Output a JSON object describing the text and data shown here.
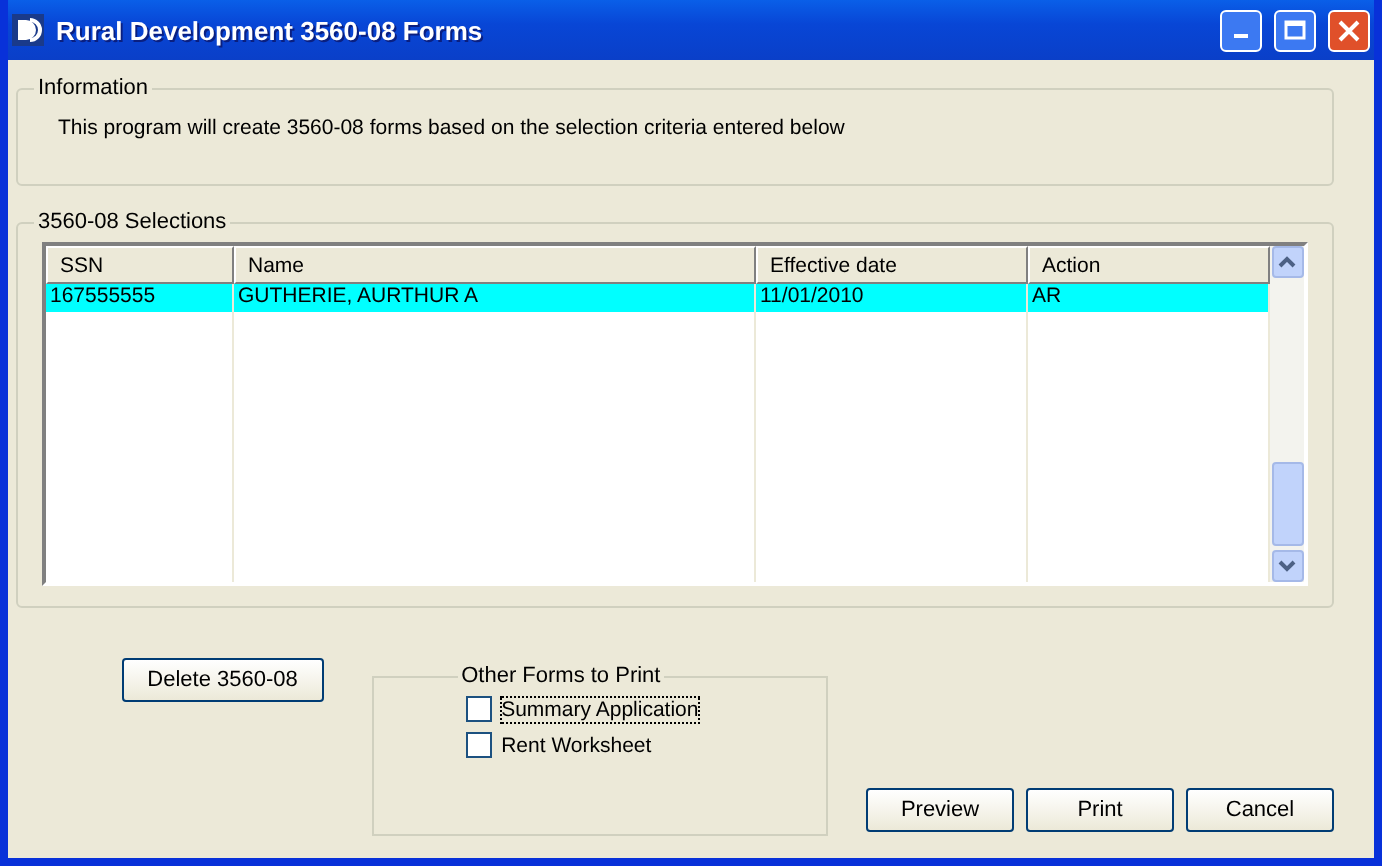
{
  "window": {
    "title": "Rural Development 3560-08 Forms"
  },
  "information": {
    "title": "Information",
    "text": "This program will create 3560-08 forms based on the selection criteria entered below"
  },
  "selections": {
    "title": "3560-08 Selections",
    "columns": [
      "SSN",
      "Name",
      "Effective date",
      "Action"
    ],
    "rows": [
      {
        "cells": [
          "167555555",
          "GUTHERIE, AURTHUR A",
          "11/01/2010",
          "AR"
        ],
        "selected": true
      }
    ]
  },
  "delete_button": "Delete 3560-08",
  "other_forms": {
    "title": "Other Forms to Print",
    "options": [
      {
        "label": "Summary Application",
        "checked": false,
        "focused": true
      },
      {
        "label": "Rent Worksheet",
        "checked": false,
        "focused": false
      }
    ]
  },
  "buttons": [
    "Preview",
    "Print",
    "Cancel"
  ]
}
